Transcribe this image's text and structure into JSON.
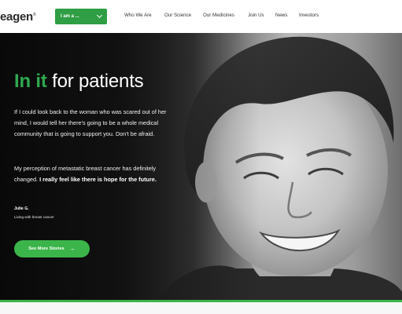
{
  "header": {
    "logo_text": "eagen",
    "logo_mark": "®",
    "audience_selector": {
      "label": "I am a ...",
      "icon": "chevron-down-icon"
    },
    "nav": [
      {
        "label": "Who We Are"
      },
      {
        "label": "Our Science"
      },
      {
        "label": "Our Medicines"
      },
      {
        "label": "Join Us"
      },
      {
        "label": "News"
      },
      {
        "label": "Investors"
      }
    ]
  },
  "hero": {
    "headline_accent": "In it",
    "headline_rest": " for patients",
    "paragraph1": "If I could look back to the woman who was scared out of her mind, I would tell her there's going to be a whole medical community that is going to support you. Don't be afraid.",
    "paragraph2_regular": "My perception of metastatic breast cancer has definitely changed. ",
    "paragraph2_bold": "I really feel like there is hope for the future.",
    "attribution_name": "Julie G.",
    "attribution_desc": "Living with breast cancer",
    "cta_label": "See More Stories",
    "cta_icon": "arrow-right-icon"
  },
  "colors": {
    "brand_green": "#2fa84f",
    "button_green": "#3bb54a",
    "selector_green": "#2f9e44"
  }
}
